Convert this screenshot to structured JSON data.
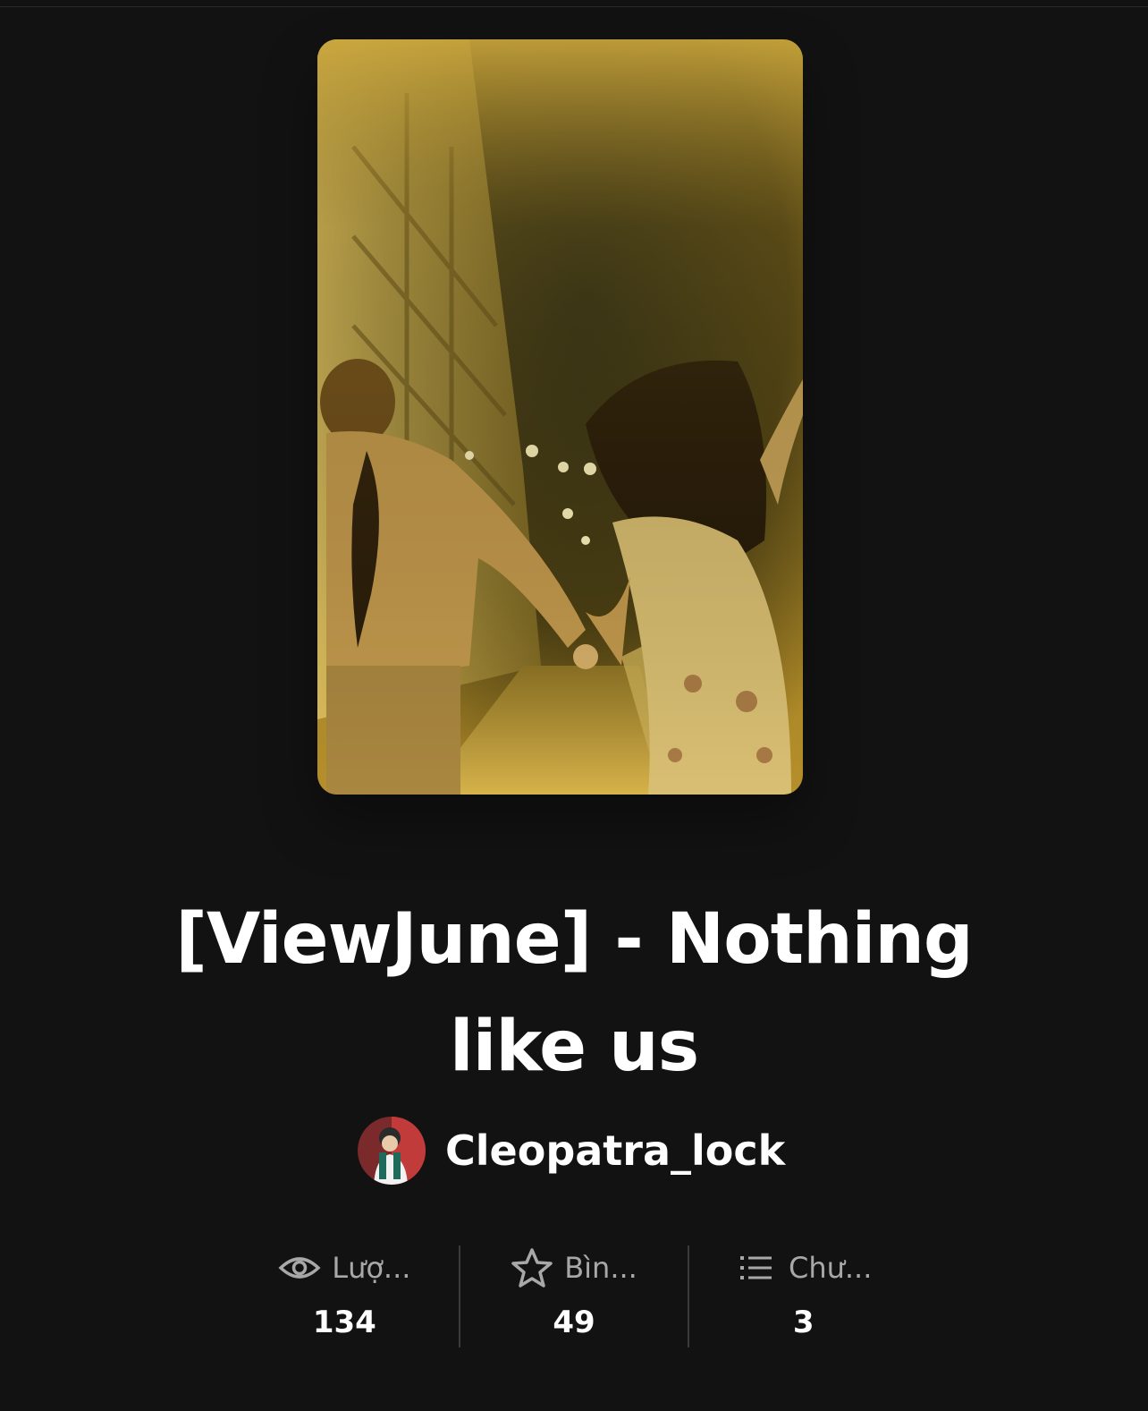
{
  "story": {
    "title_line1": "[ViewJune] - Nothing",
    "title_line2": "like us",
    "author": {
      "name": "Cleopatra_lock"
    }
  },
  "stats": [
    {
      "icon": "eye-icon",
      "label": "Lượ...",
      "value": "134"
    },
    {
      "icon": "star-icon",
      "label": "Bìn...",
      "value": "49"
    },
    {
      "icon": "list-icon",
      "label": "Chư...",
      "value": "3"
    }
  ],
  "colors": {
    "background": "#121212",
    "text": "#ffffff",
    "muted": "#a8a8a8",
    "divider": "#3a3a3a"
  }
}
